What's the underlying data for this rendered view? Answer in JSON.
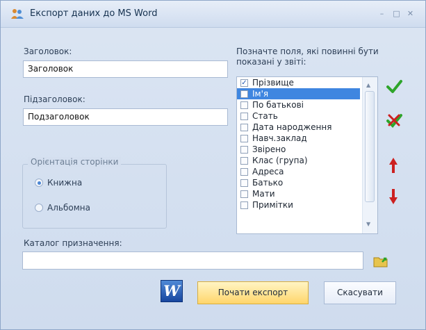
{
  "window": {
    "title": "Експорт даних до MS Word",
    "minimize": "–",
    "maximize": "□",
    "close": "✕"
  },
  "form": {
    "heading_label": "Заголовок:",
    "heading_value": "Заголовок",
    "subheading_label": "Підзаголовок:",
    "subheading_value": "Подзаголовок",
    "orientation_title": "Орієнтація сторінки",
    "portrait": "Книжна",
    "landscape": "Альбомна",
    "fields_label": "Позначте поля, які повинні бути показані у звіті:",
    "fields": [
      {
        "label": "Прізвище",
        "checked": true
      },
      {
        "label": "Ім'я",
        "checked": false
      },
      {
        "label": "По батькові",
        "checked": false
      },
      {
        "label": "Стать",
        "checked": false
      },
      {
        "label": "Дата народження",
        "checked": false
      },
      {
        "label": "Навч.заклад",
        "checked": false
      },
      {
        "label": "Звірено",
        "checked": false
      },
      {
        "label": "Клас (група)",
        "checked": false
      },
      {
        "label": "Адреса",
        "checked": false
      },
      {
        "label": "Батько",
        "checked": false
      },
      {
        "label": "Мати",
        "checked": false
      },
      {
        "label": "Примітки",
        "checked": false
      }
    ],
    "destination_label": "Каталог призначення:",
    "destination_value": ""
  },
  "buttons": {
    "start": "Почати експорт",
    "cancel": "Скасувати",
    "word_letter": "W"
  },
  "colors": {
    "accent": "#3f86e0",
    "primary_button": "#ffd56b",
    "check_green": "#2ea52b",
    "remove_red": "#cc2020"
  }
}
